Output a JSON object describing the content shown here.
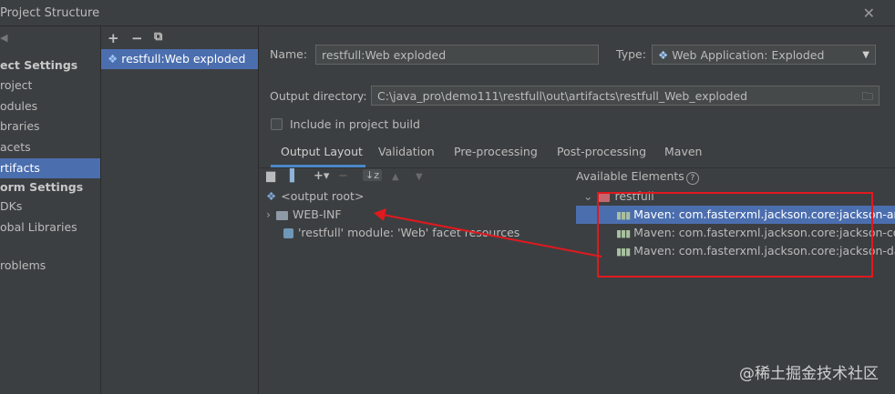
{
  "window": {
    "title": "Project Structure",
    "close_icon": "close-icon"
  },
  "left_nav": {
    "items": [
      {
        "label": "ect Settings",
        "kind": "header"
      },
      {
        "label": "roject",
        "kind": "item"
      },
      {
        "label": "odules",
        "kind": "item"
      },
      {
        "label": "braries",
        "kind": "item"
      },
      {
        "label": "acets",
        "kind": "item"
      },
      {
        "label": "rtifacts",
        "kind": "selected"
      },
      {
        "label": "orm Settings",
        "kind": "header"
      },
      {
        "label": "DKs",
        "kind": "item"
      },
      {
        "label": "obal Libraries",
        "kind": "item"
      },
      {
        "label": "roblems",
        "kind": "item"
      }
    ]
  },
  "artifacts_list": {
    "toolbar": {
      "add": "+",
      "remove": "−",
      "copy": "⧉"
    },
    "items": [
      {
        "label": "restfull:Web exploded",
        "icon": "web-artifact-icon"
      }
    ]
  },
  "form": {
    "name_label": "Name:",
    "name_value": "restfull:Web exploded",
    "type_label": "Type:",
    "type_value": "Web Application: Exploded",
    "output_dir_label": "Output directory:",
    "output_dir_value": "C:\\java_pro\\demo111\\restfull\\out\\artifacts\\restfull_Web_exploded",
    "include_build_label": "Include in project build",
    "include_build_checked": false
  },
  "tabs": [
    {
      "label": "Output Layout",
      "active": true
    },
    {
      "label": "Validation",
      "active": false
    },
    {
      "label": "Pre-processing",
      "active": false
    },
    {
      "label": "Post-processing",
      "active": false
    },
    {
      "label": "Maven",
      "active": false
    }
  ],
  "output_tree": {
    "items": [
      {
        "label": "<output root>",
        "icon": "output-root-icon"
      },
      {
        "label": "WEB-INF",
        "icon": "folder-icon",
        "expandable": true
      },
      {
        "label": "'restfull' module: 'Web' facet resources",
        "icon": "module-icon"
      }
    ]
  },
  "available": {
    "header": "Available Elements",
    "help": "?",
    "root": "restfull",
    "items": [
      {
        "label": "Maven: com.fasterxml.jackson.core:jackson-annot",
        "selected": true
      },
      {
        "label": "Maven: com.fasterxml.jackson.core:jackson-core:",
        "selected": false
      },
      {
        "label": "Maven: com.fasterxml.jackson.core:jackson-datab",
        "selected": false
      }
    ]
  },
  "watermark": "@稀土掘金技术社区",
  "colors": {
    "background": "#3c3f41",
    "selection": "#4b6eaf",
    "annotation": "#e0191f",
    "tab_underline": "#4a88c7"
  }
}
